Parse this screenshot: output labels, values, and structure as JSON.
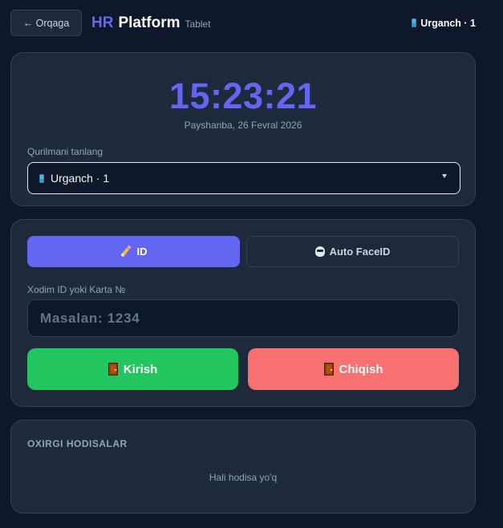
{
  "header": {
    "back_label": "← Orqaga",
    "brand_hr": "HR",
    "brand_platform": "Platform",
    "brand_sub": "Tablet",
    "device": "Urganch · 1"
  },
  "clock": {
    "time": "15:23:21",
    "date": "Payshanba, 26 Fevral 2026"
  },
  "device_select": {
    "label": "Qurilmani tanlang",
    "selected": "Urganch · 1"
  },
  "auth": {
    "tabs": [
      {
        "label": "ID",
        "icon": "pencil-icon",
        "active": true
      },
      {
        "label": "Auto FaceID",
        "icon": "face-icon",
        "active": false
      }
    ],
    "input_label": "Xodim ID yoki Karta №",
    "input_placeholder": "Masalan: 1234",
    "input_value": ""
  },
  "actions": {
    "enter_label": "Kirish",
    "exit_label": "Chiqish"
  },
  "events": {
    "title": "OXIRGI HODISALAR",
    "empty": "Hali hodisa yo'q"
  },
  "colors": {
    "accent": "#6366f1",
    "enter": "#22c55e",
    "exit": "#f87171",
    "background": "#0f172a",
    "card": "#1e293b"
  }
}
